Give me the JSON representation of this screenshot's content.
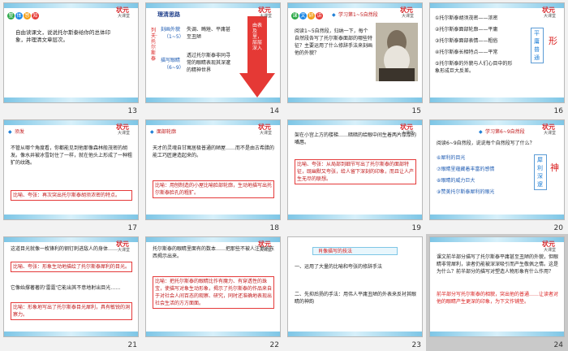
{
  "slides": [
    {
      "num": "13",
      "tag": [
        "整",
        "体",
        "感",
        "知"
      ],
      "text": "自由读课文，说说托尔斯泰给你的总体印象，并理清文章层次。"
    },
    {
      "num": "14",
      "heading": "理清思路",
      "left": "列夫·托尔斯泰",
      "parts": [
        {
          "name": "刻画外貌",
          "range": "（1~5）",
          "desc": "失调、畸矬、平庸甚至丑陋"
        },
        {
          "name": "描写眼睛",
          "range": "（6~9）",
          "desc": "透过托尔斯泰非同寻常的眼睛表现其深邃的精神世界"
        }
      ],
      "arrow": "由表及里，层层深入"
    },
    {
      "num": "15",
      "tag": [
        "课",
        "文",
        "研",
        "讲"
      ],
      "bar": "学习第1~5自然段",
      "text": "阅读1~5自然段，归纳一下，每个自然段各写了托尔斯泰面部的哪些特征？主要运用了什么修辞手法来刻画他的外貌？"
    },
    {
      "num": "16",
      "items": [
        "①托尔斯泰胡须茂密——浓密",
        "②托尔斯泰面部轮廓——平庸",
        "③托尔斯泰面部表情——粗俗",
        "④托尔斯泰长相特点——平常",
        "⑤托尔斯泰的外貌与人们心目中的形象形成巨大反差。"
      ],
      "vert": "平庸普通",
      "side": "形"
    },
    {
      "num": "17",
      "bar": "须发",
      "text": "不管从哪个角度看，你都能见到他那像森林般茂密的胡发。像水井被冰雪封住了一样，就在他头上形成了一种粗犷的纹路。",
      "box": "比喻、夸张：再次突出托尔斯泰胡须浓密的特点。"
    },
    {
      "num": "18",
      "bar": "面部轮廓",
      "text": "天才的灵魂自甘寓居极普通的陋屋……而不是由古希腊的能工巧匠建造起来的。",
      "box": "比喻：用刨制造的小屋比喻脸部轮廓，生动地描写出托尔斯泰脸孔的粗犷。"
    },
    {
      "num": "19",
      "text": "架在小宫上方的楼梯……暗暗的给眼中间生着两片厚厚的嘴唇。",
      "box": "比喻、夸张：从局部到细节写出了托尔斯泰的面部特征，既幽默又夸张，给人留下深刻的印象，而且让人产生无尽的联想。"
    },
    {
      "num": "20",
      "bar": "学习第6~9自然段",
      "q": "阅读6~9自然段，说说每个自然段写了什么？",
      "items": [
        "⑥犀利的目光",
        "⑦眼睛里蕴藏着丰富的感情",
        "⑧眼睛的威力巨大",
        "⑨赞美托尔斯泰犀利的眼光"
      ],
      "vert": "犀利深邃",
      "side": "神"
    },
    {
      "num": "21",
      "text": "这道目光就像一枚锋利的钢钉刺进敌人的身体……",
      "box1": "比喻、夸张：形象生动地描绘了托尔斯泰犀利的目光。",
      "text2": "它像始撑著著的'雷霆'它能出其不意地射出目光……",
      "box2": "比喻：形象地写出了托尔斯泰目光犀利，具有敏锐的洞察力。"
    },
    {
      "num": "22",
      "text": "托尔斯泰的眼睛里面有的数本……把那些不被人注意的东西揭示出来。",
      "box": "比喻：把托尔斯泰的眼睛比作有魔力、有穿透性的珠宝，使描写对象生动形象，揭示了托尔斯泰的作品来自于对社会人间百态的观察、研究，同时还准确地表现出社会生活的方方面面。"
    },
    {
      "num": "23",
      "title": "肖像描写的技法",
      "p1": "一、运用了大量的比喻和夸张的修辞手法",
      "p2": "二、先抑后扬的手法：用伟人平庸丑陋的外表来反衬其眼睛的神韵"
    },
    {
      "num": "24",
      "text": "课文前半部分描写了托尔斯泰平庸甚至丑陋的外貌，但眼睛非常犀利，读者仍能被深深吸引而产生敬佩之情。这是为什么？前半部分的描写对塑造人物形象有什么作用？",
      "box": "前半部分写托尔斯泰的相貌，突出他的普通……让读者对他的眼睛产生更深的印象，为下文作铺垫。"
    }
  ]
}
